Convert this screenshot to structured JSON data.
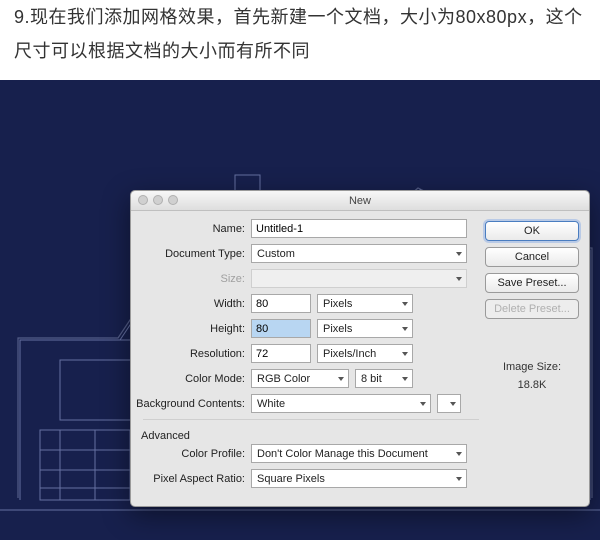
{
  "article": {
    "text": "9.现在我们添加网格效果，首先新建一个文档，大小为80x80px，这个尺寸可以根据文档的大小而有所不同"
  },
  "dialog": {
    "title": "New",
    "labels": {
      "name": "Name:",
      "doctype": "Document Type:",
      "size": "Size:",
      "width": "Width:",
      "height": "Height:",
      "resolution": "Resolution:",
      "colormode": "Color Mode:",
      "bgcontents": "Background Contents:",
      "advanced": "Advanced",
      "colorprofile": "Color Profile:",
      "pixelaspect": "Pixel Aspect Ratio:"
    },
    "values": {
      "name": "Untitled-1",
      "doctype": "Custom",
      "size": "",
      "width": "80",
      "height": "80",
      "resolution": "72",
      "colormode": "RGB Color",
      "bitdepth": "8 bit",
      "bgcontents": "White",
      "colorprofile": "Don't Color Manage this Document",
      "pixelaspect": "Square Pixels",
      "unit_px": "Pixels",
      "unit_res": "Pixels/Inch"
    },
    "buttons": {
      "ok": "OK",
      "cancel": "Cancel",
      "savepreset": "Save Preset...",
      "deletepreset": "Delete Preset..."
    },
    "imagesize": {
      "label": "Image Size:",
      "value": "18.8K"
    }
  }
}
